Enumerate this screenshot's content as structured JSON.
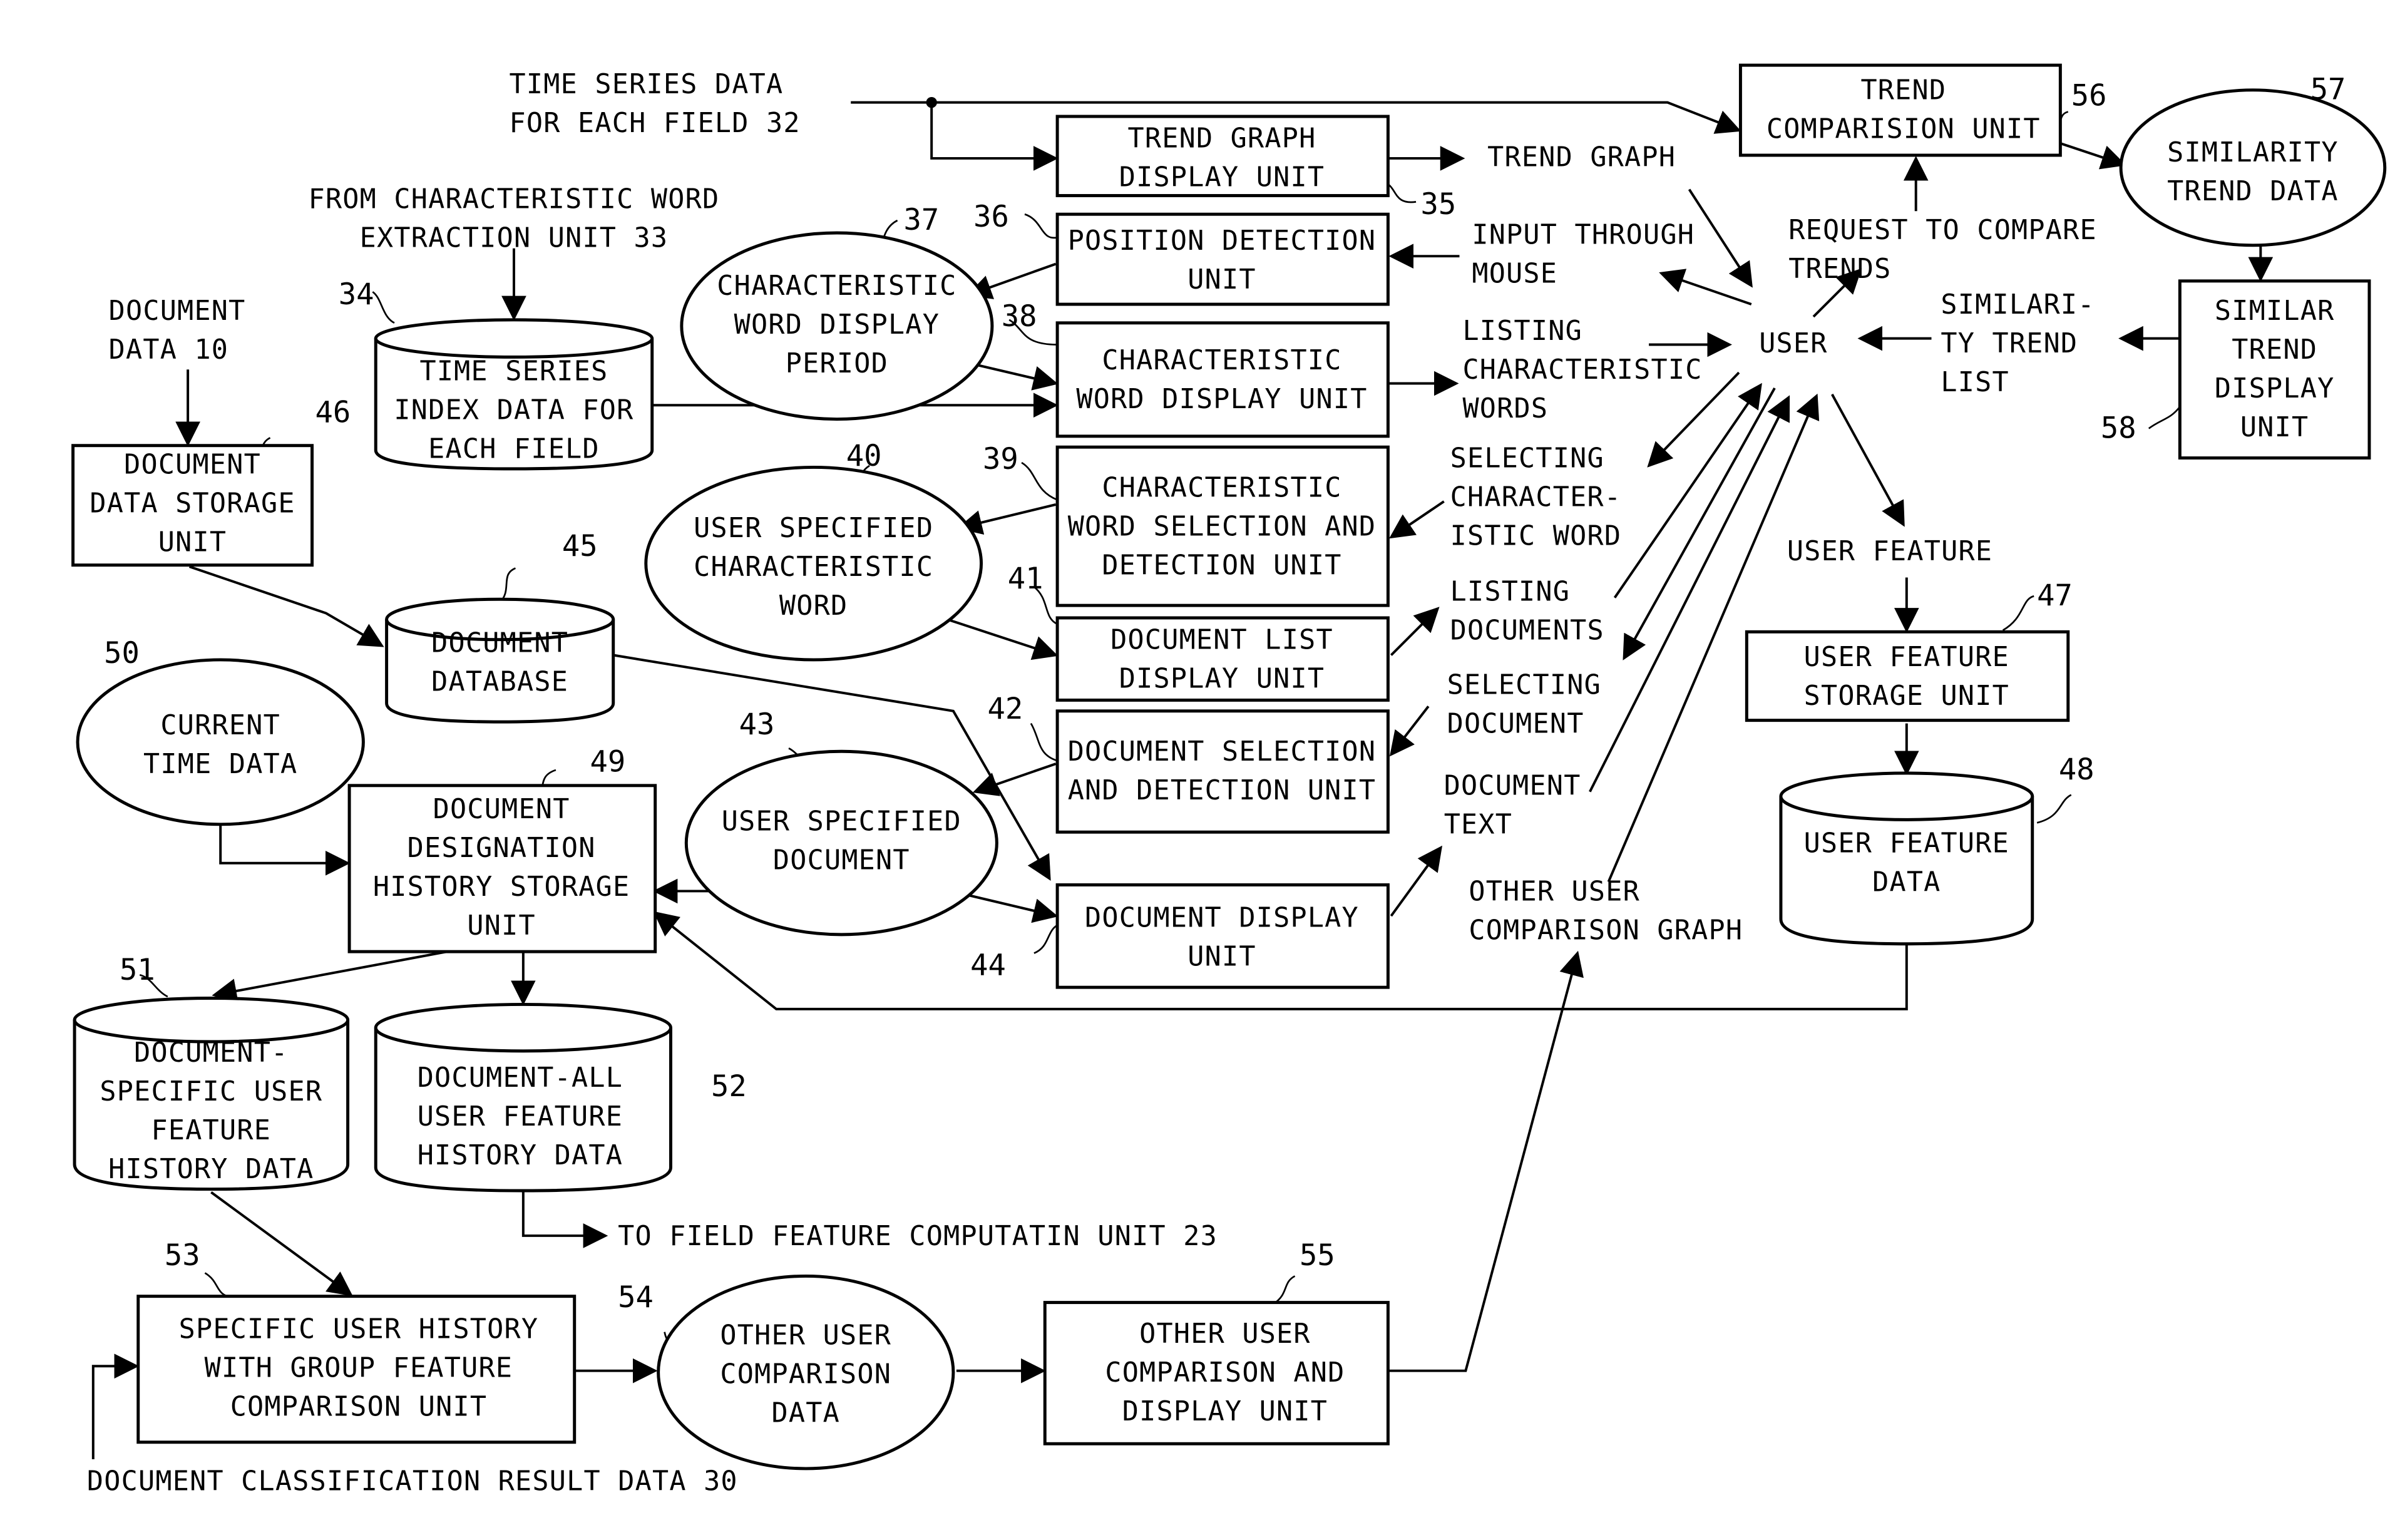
{
  "figure": {
    "colors": {
      "ink": "#000000",
      "paper": "#ffffff"
    },
    "nodes": {
      "time_series_input": {
        "lines": [
          "TIME SERIES DATA",
          "FOR EACH FIELD 32"
        ]
      },
      "char_word_source": {
        "lines": [
          "FROM CHARACTERISTIC WORD",
          "EXTRACTION UNIT 33"
        ]
      },
      "document_data_input": {
        "lines": [
          "DOCUMENT",
          "DATA 10"
        ]
      },
      "trend_graph_display_unit": {
        "ref": "35",
        "lines": [
          "TREND GRAPH",
          "DISPLAY UNIT"
        ]
      },
      "position_detection_unit": {
        "ref": "36",
        "lines": [
          "POSITION DETECTION",
          "UNIT"
        ]
      },
      "char_word_display_period": {
        "ref": "37",
        "lines": [
          "CHARACTERISTIC",
          "WORD DISPLAY",
          "PERIOD"
        ]
      },
      "char_word_display_unit": {
        "ref": "38",
        "lines": [
          "CHARACTERISTIC",
          "WORD DISPLAY UNIT"
        ]
      },
      "char_word_selection_unit": {
        "ref": "39",
        "lines": [
          "CHARACTERISTIC",
          "WORD SELECTION AND",
          "DETECTION UNIT"
        ]
      },
      "user_specified_char_word": {
        "ref": "40",
        "lines": [
          "USER SPECIFIED",
          "CHARACTERISTIC",
          "WORD"
        ]
      },
      "document_list_display_unit": {
        "ref": "41",
        "lines": [
          "DOCUMENT LIST",
          "DISPLAY UNIT"
        ]
      },
      "document_selection_unit": {
        "ref": "42",
        "lines": [
          "DOCUMENT SELECTION",
          "AND DETECTION UNIT"
        ]
      },
      "user_specified_document": {
        "ref": "43",
        "lines": [
          "USER SPECIFIED",
          "DOCUMENT"
        ]
      },
      "document_display_unit": {
        "ref": "44",
        "lines": [
          "DOCUMENT DISPLAY",
          "UNIT"
        ]
      },
      "document_database": {
        "ref": "45",
        "lines": [
          "DOCUMENT",
          "DATABASE"
        ]
      },
      "document_data_storage_unit": {
        "ref": "46",
        "lines": [
          "DOCUMENT",
          "DATA STORAGE",
          "UNIT"
        ]
      },
      "user_feature_storage_unit": {
        "ref": "47",
        "lines": [
          "USER FEATURE",
          "STORAGE UNIT"
        ]
      },
      "user_feature_data": {
        "ref": "48",
        "lines": [
          "USER FEATURE",
          "DATA"
        ]
      },
      "doc_designation_history_unit": {
        "ref": "49",
        "lines": [
          "DOCUMENT",
          "DESIGNATION",
          "HISTORY STORAGE",
          "UNIT"
        ]
      },
      "current_time_data": {
        "ref": "50",
        "lines": [
          "CURRENT",
          "TIME DATA"
        ]
      },
      "doc_specific_history_data": {
        "ref": "51",
        "lines": [
          "DOCUMENT-",
          "SPECIFIC USER",
          "FEATURE",
          "HISTORY DATA"
        ]
      },
      "doc_all_history_data": {
        "ref": "52",
        "lines": [
          "DOCUMENT-ALL",
          "USER FEATURE",
          "HISTORY DATA"
        ]
      },
      "group_feature_comparison_unit": {
        "ref": "53",
        "lines": [
          "SPECIFIC USER HISTORY",
          "WITH GROUP FEATURE",
          "COMPARISON UNIT"
        ]
      },
      "other_user_comparison_data": {
        "ref": "54",
        "lines": [
          "OTHER USER",
          "COMPARISON",
          "DATA"
        ]
      },
      "other_user_comparison_display_unit": {
        "ref": "55",
        "lines": [
          "OTHER USER",
          "COMPARISON AND",
          "DISPLAY UNIT"
        ]
      },
      "trend_comparison_unit": {
        "ref": "56",
        "lines": [
          "TREND",
          "COMPARISION UNIT"
        ]
      },
      "similarity_trend_data": {
        "ref": "57",
        "lines": [
          "SIMILARITY",
          "TREND DATA"
        ]
      },
      "similar_trend_display_unit": {
        "ref": "58",
        "lines": [
          "SIMILAR",
          "TREND",
          "DISPLAY",
          "UNIT"
        ]
      },
      "user": {
        "lines": [
          "USER"
        ]
      }
    },
    "flow_labels": {
      "trend_graph": {
        "lines": [
          "TREND GRAPH"
        ]
      },
      "input_through_mouse": {
        "lines": [
          "INPUT THROUGH",
          "MOUSE"
        ]
      },
      "request_to_compare": {
        "lines": [
          "REQUEST TO COMPARE",
          "TRENDS"
        ]
      },
      "listing_char_words": {
        "lines": [
          "LISTING",
          "CHARACTERISTIC",
          "WORDS"
        ]
      },
      "similarity_trend_list": {
        "lines": [
          "SIMILARI-",
          "TY TREND",
          "LIST"
        ]
      },
      "selecting_char_word": {
        "lines": [
          "SELECTING",
          "CHARACTER-",
          "ISTIC WORD"
        ]
      },
      "user_feature": {
        "lines": [
          "USER FEATURE"
        ]
      },
      "listing_documents": {
        "lines": [
          "LISTING",
          "DOCUMENTS"
        ]
      },
      "selecting_document": {
        "lines": [
          "SELECTING",
          "DOCUMENT"
        ]
      },
      "document_text": {
        "lines": [
          "DOCUMENT",
          "TEXT"
        ]
      },
      "other_user_graph": {
        "lines": [
          "OTHER USER",
          "COMPARISON GRAPH"
        ]
      },
      "to_field_feature": {
        "lines": [
          "TO FIELD FEATURE COMPUTATIN UNIT 23"
        ]
      },
      "doc_classification": {
        "lines": [
          "DOCUMENT CLASSIFICATION RESULT DATA 30"
        ]
      }
    }
  }
}
